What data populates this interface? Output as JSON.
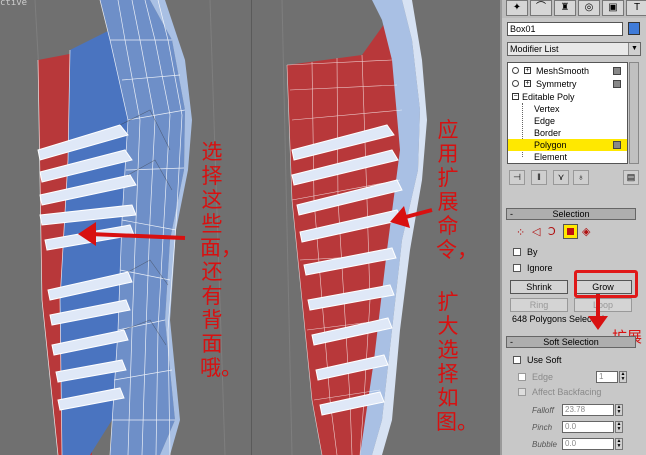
{
  "viewport": {
    "label": "ctive"
  },
  "annotation_left": {
    "text": "选择这些面，还有背面哦。"
  },
  "annotation_right_col1": {
    "text": "应用扩展命令，"
  },
  "annotation_right_col2": {
    "text": "扩大选择如图。"
  },
  "annotation_grow": {
    "text": "扩展"
  },
  "panel": {
    "object_name": "Box01",
    "object_color": "#3f7bd8",
    "modifier_list": "Modifier List",
    "stack": [
      {
        "label": "MeshSmooth"
      },
      {
        "label": "Symmetry"
      },
      {
        "label": "Editable Poly"
      },
      {
        "label": "Vertex"
      },
      {
        "label": "Edge"
      },
      {
        "label": "Border"
      },
      {
        "label": "Polygon"
      },
      {
        "label": "Element"
      }
    ],
    "selection": {
      "title": "Selection",
      "by_label": "By",
      "ignore_label": "Ignore",
      "shrink": "Shrink",
      "grow": "Grow",
      "ring": "Ring",
      "loop": "Loop",
      "status": "648 Polygons Selected"
    },
    "soft_selection": {
      "title": "Soft Selection",
      "use_soft": "Use Soft",
      "edge": "Edge",
      "edge_value": "1",
      "affect_backfacing": "Affect Backfacing",
      "falloff_label": "Falloff",
      "falloff_value": "23.78",
      "pinch_label": "Pinch",
      "pinch_value": "0.0",
      "bubble_label": "Bubble",
      "bubble_value": "0.0"
    }
  },
  "colors": {
    "selected_red": "#b8383a",
    "mesh_blue": "#4a74c0",
    "annotation": "#d81010",
    "highlight": "#ffe800"
  }
}
